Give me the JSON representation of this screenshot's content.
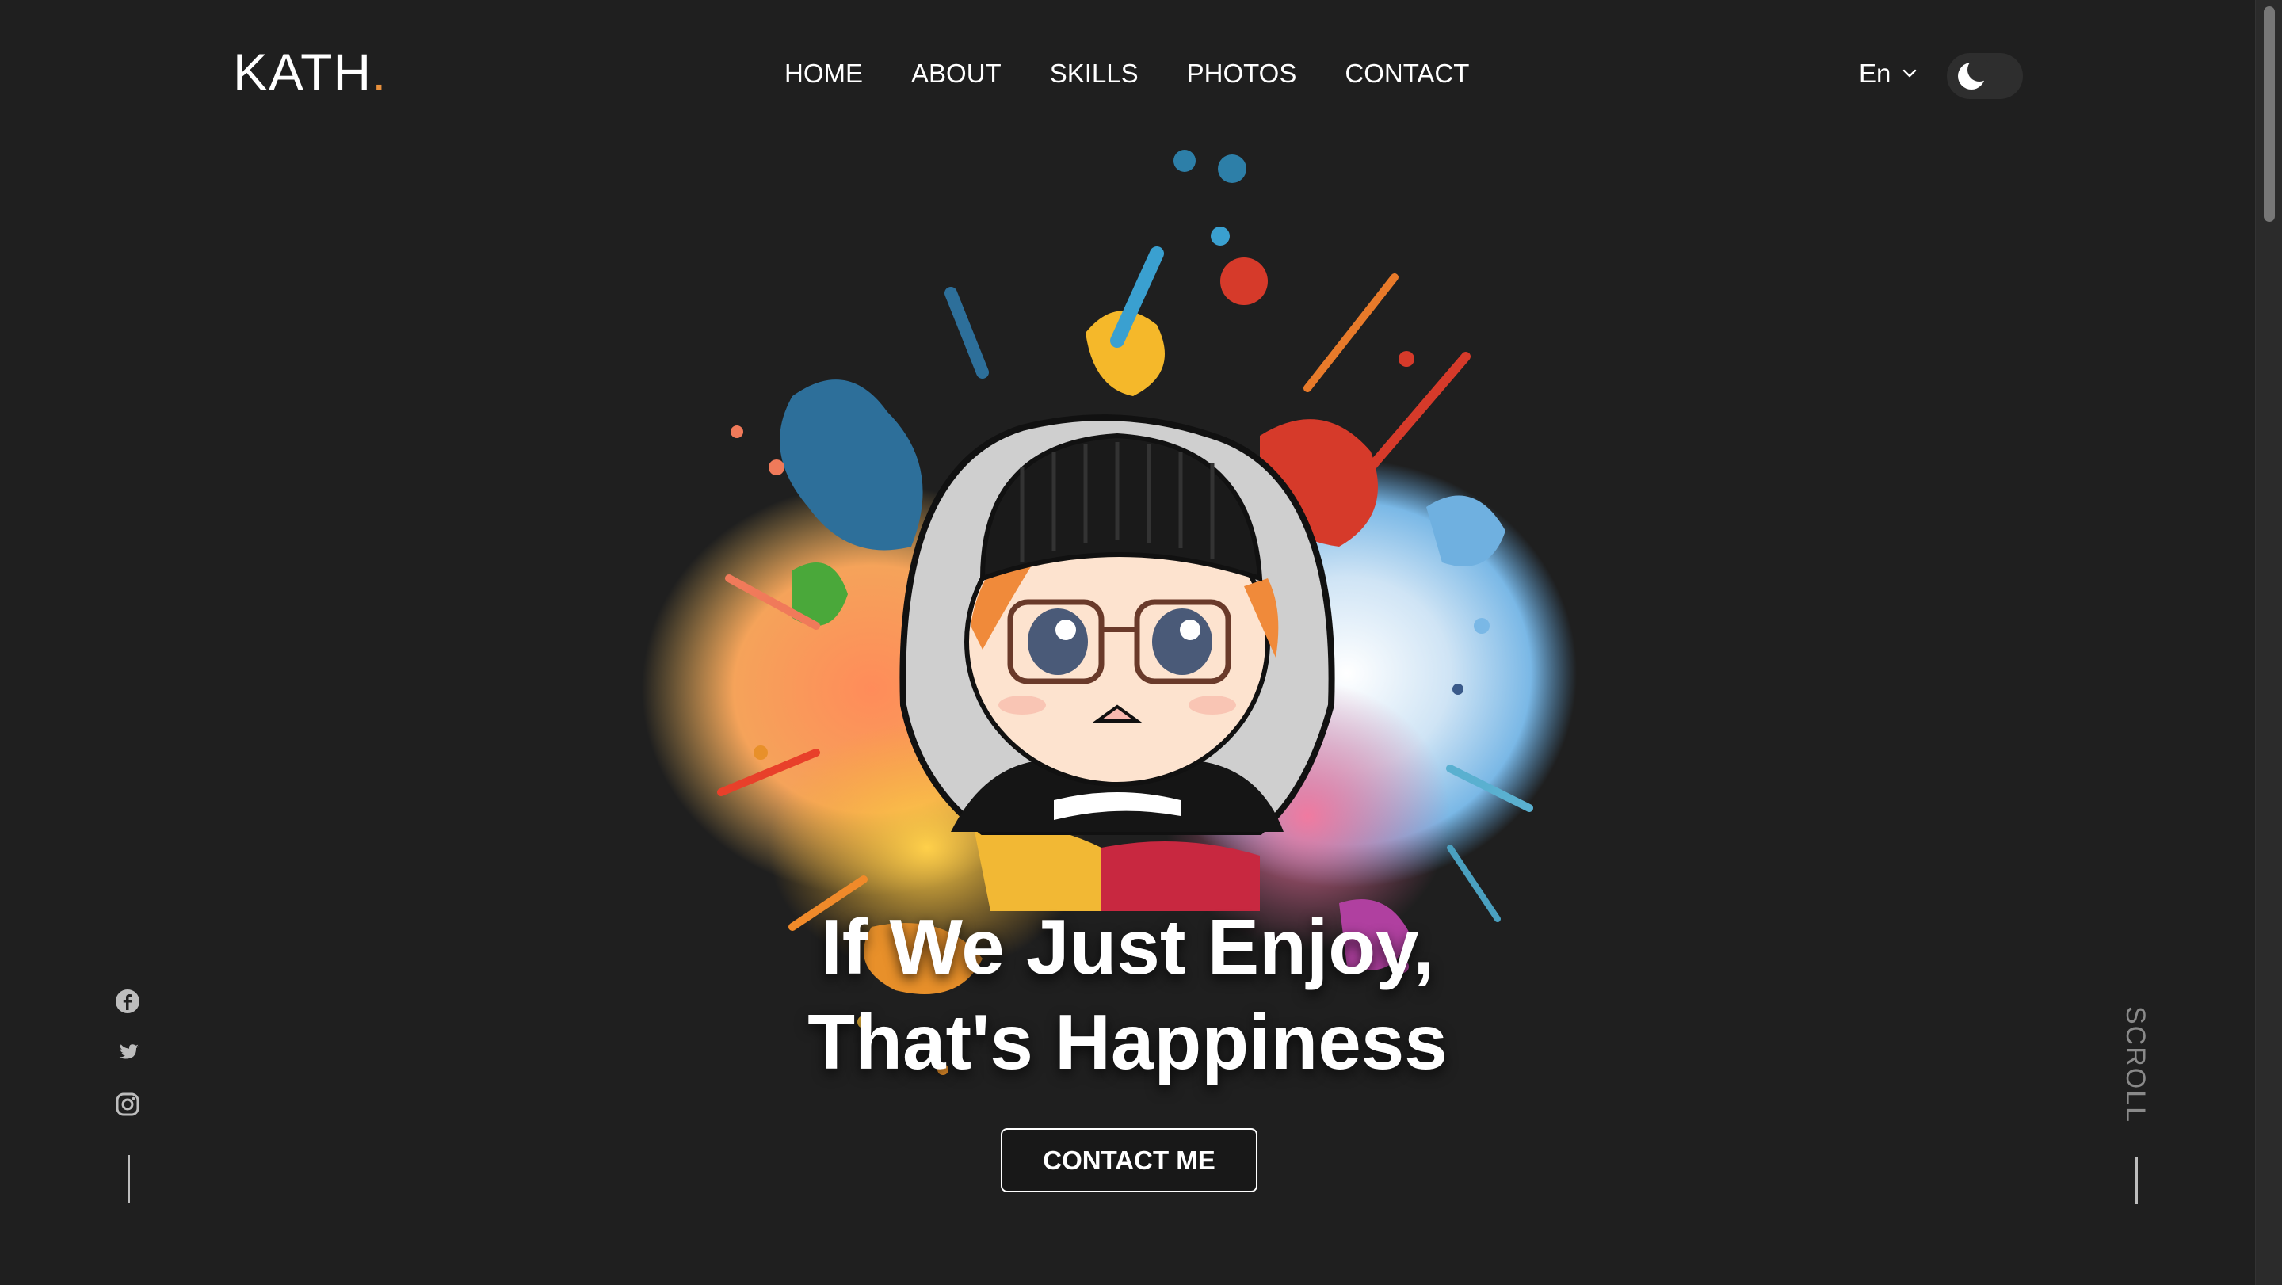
{
  "brand": {
    "name": "KATH",
    "dot": "."
  },
  "nav": {
    "items": [
      {
        "label": "HOME"
      },
      {
        "label": "ABOUT"
      },
      {
        "label": "SKILLS"
      },
      {
        "label": "PHOTOS"
      },
      {
        "label": "CONTACT"
      }
    ]
  },
  "language": {
    "selected": "En",
    "icon": "chevron-down-icon"
  },
  "theme_toggle": {
    "icon": "moon-icon",
    "mode": "dark"
  },
  "hero": {
    "line1": "If We Just Enjoy,",
    "line2": "That's Happiness",
    "cta_label": "CONTACT ME"
  },
  "social": {
    "icons": [
      "facebook-icon",
      "twitter-icon",
      "instagram-icon"
    ]
  },
  "scroll": {
    "label": "SCROLL"
  },
  "colors": {
    "background": "#1f1f1f",
    "accent": "#e8903c",
    "text": "#ffffff",
    "muted": "#8a8a8a"
  }
}
